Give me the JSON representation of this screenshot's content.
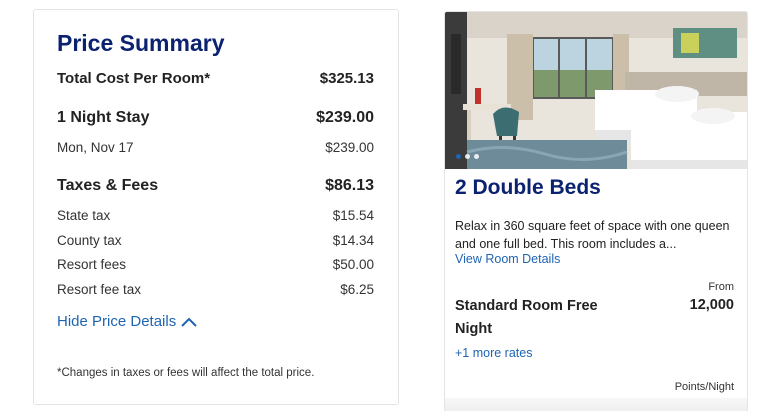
{
  "price_summary": {
    "title": "Price Summary",
    "total_label": "Total Cost Per Room*",
    "total_value": "$325.13",
    "stay_label": "1 Night Stay",
    "stay_value": "$239.00",
    "nights": [
      {
        "date": "Mon, Nov 17",
        "price": "$239.00"
      }
    ],
    "taxes_label": "Taxes & Fees",
    "taxes_value": "$86.13",
    "fees": [
      {
        "label": "State tax",
        "value": "$15.54"
      },
      {
        "label": "County tax",
        "value": "$14.34"
      },
      {
        "label": "Resort fees",
        "value": "$50.00"
      },
      {
        "label": "Resort fee tax",
        "value": "$6.25"
      }
    ],
    "hide_details_label": "Hide Price Details",
    "footnote": "*Changes in taxes or fees will affect the total price."
  },
  "room": {
    "title": "2 Double Beds",
    "description": "Relax in 360 square feet of space with one queen and one full bed. This room includes a...",
    "details_link": "View Room Details",
    "photo_count": 3,
    "photo_active_index": 0,
    "rate": {
      "from_label": "From",
      "name": "Standard Room Free Night",
      "points": "12,000",
      "unit_label": "Points/Night"
    },
    "more_rates_label": "+1 more rates"
  },
  "colors": {
    "title_navy": "#0b2270",
    "link_blue": "#1f64b3"
  },
  "icons": {
    "hide_details": "chevron-up-icon"
  }
}
